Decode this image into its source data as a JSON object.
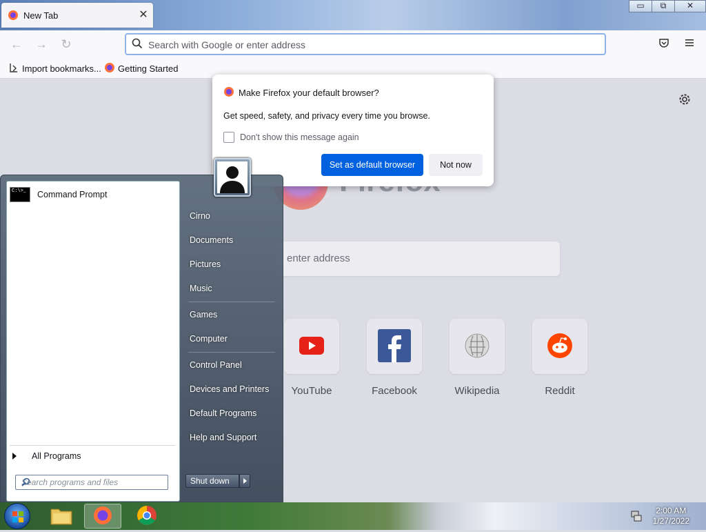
{
  "browser": {
    "tab_title": "New Tab",
    "tab_close": "✕",
    "window_buttons": {
      "minimize": "▭",
      "restore": "⧉",
      "close": "✕"
    },
    "url_placeholder": "Search with Google or enter address",
    "bookmarks": [
      {
        "label": "Import bookmarks...",
        "icon": "import-icon"
      },
      {
        "label": "Getting Started",
        "icon": "firefox-icon"
      }
    ]
  },
  "newtab": {
    "logo_word": "Firefox",
    "search_placeholder_visible": "enter address",
    "shortcuts": [
      {
        "label": "YouTube",
        "icon": "youtube-icon",
        "color": "#e62117"
      },
      {
        "label": "Facebook",
        "icon": "facebook-icon",
        "color": "#3b5998"
      },
      {
        "label": "Wikipedia",
        "icon": "wikipedia-icon",
        "color": "#888888"
      },
      {
        "label": "Reddit",
        "icon": "reddit-icon",
        "color": "#ff4500"
      }
    ]
  },
  "dialog": {
    "title": "Make Firefox your default browser?",
    "message": "Get speed, safety, and privacy every time you browse.",
    "checkbox_label": "Don't show this message again",
    "checkbox_checked": false,
    "primary_button": "Set as default browser",
    "secondary_button": "Not now",
    "accent": "#0061e0"
  },
  "startmenu": {
    "pinned": [
      {
        "label": "Command Prompt",
        "icon": "command-prompt-icon"
      }
    ],
    "cmd_icon_text": "C:\\>_",
    "all_programs": "All Programs",
    "search_placeholder": "Search programs and files",
    "right_items": [
      "Cirno",
      "Documents",
      "Pictures",
      "Music",
      "Games",
      "Computer",
      "Control Panel",
      "Devices and Printers",
      "Default Programs",
      "Help and Support"
    ],
    "shutdown": "Shut down"
  },
  "taskbar": {
    "items": [
      {
        "name": "windows-explorer",
        "icon": "folder-icon"
      },
      {
        "name": "firefox",
        "icon": "firefox-icon",
        "active": true
      },
      {
        "name": "chrome",
        "icon": "chrome-icon"
      }
    ],
    "time": "2:00 AM",
    "date": "1/27/2022"
  }
}
